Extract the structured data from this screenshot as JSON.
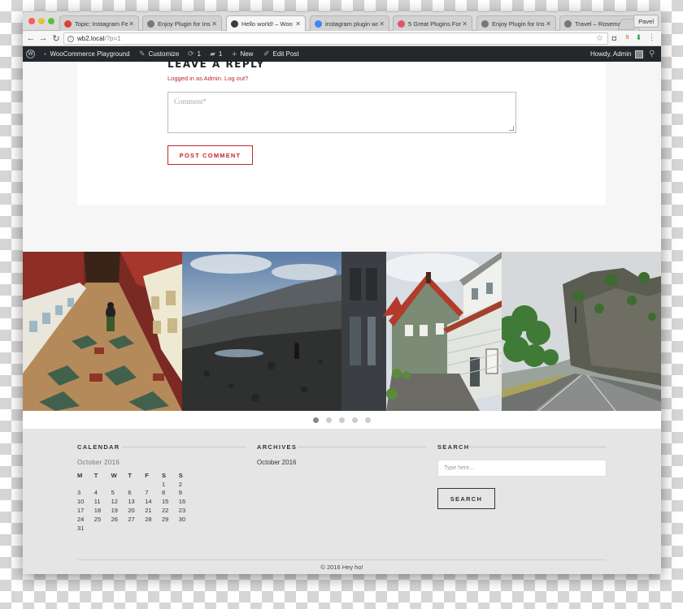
{
  "browser": {
    "tabs": [
      {
        "title": "Topic: Instagram Fe",
        "favicon": "red-plane-icon",
        "color": "#d9413a"
      },
      {
        "title": "Enjoy Plugin for Ins",
        "favicon": "page-icon",
        "color": "#777777"
      },
      {
        "title": "Hello world! – Woo",
        "favicon": "wordpress-icon",
        "color": "#3c3c3c",
        "active": true
      },
      {
        "title": "instagram plugin wo",
        "favicon": "google-icon",
        "color": "#4285f4"
      },
      {
        "title": "5 Great Plugins For",
        "favicon": "star-burst-icon",
        "color": "#e0556b"
      },
      {
        "title": "Enjoy Plugin for Ins",
        "favicon": "wordpress-icon",
        "color": "#777777"
      },
      {
        "title": "Travel – Rosemary",
        "favicon": "wordpress-icon",
        "color": "#777777"
      }
    ],
    "tab_close": "✕",
    "profile_name": "Pavel",
    "url_host": "wb2.local",
    "url_path": "/?p=1"
  },
  "adminbar": {
    "site_name": "WooCommerce Playground",
    "customize": "Customize",
    "updates_count": "1",
    "comments_count": "1",
    "new_label": "New",
    "edit_post": "Edit Post",
    "greeting": "Howdy, Admin"
  },
  "reply": {
    "title": "LEAVE A REPLY",
    "logged_in": "Logged in as Admin. Log out?",
    "comment_placeholder": "Comment*",
    "post_button": "POST COMMENT"
  },
  "gallery": {
    "slide_count": 5,
    "active_index": 0
  },
  "footer": {
    "calendar": {
      "title": "CALENDAR",
      "caption": "October 2016",
      "days": [
        "M",
        "T",
        "W",
        "T",
        "F",
        "S",
        "S"
      ],
      "weeks": [
        [
          "",
          "",
          "",
          "",
          "",
          "1",
          "2"
        ],
        [
          "3",
          "4",
          "5",
          "6",
          "7",
          "8",
          "9"
        ],
        [
          "10",
          "11",
          "12",
          "13",
          "14",
          "15",
          "16"
        ],
        [
          "17",
          "18",
          "19",
          "20",
          "21",
          "22",
          "23"
        ],
        [
          "24",
          "25",
          "26",
          "27",
          "28",
          "29",
          "30"
        ],
        [
          "31",
          "",
          "",
          "",
          "",
          "",
          ""
        ]
      ]
    },
    "archives": {
      "title": "ARCHIVES",
      "items": [
        "October 2016"
      ]
    },
    "search": {
      "title": "SEARCH",
      "placeholder": "Type here...",
      "button": "SEARCH"
    },
    "copyright": "© 2016 Hey ho!"
  },
  "colors": {
    "accent_red": "#c1272d",
    "admin_bar": "#23282d",
    "footer_bg": "#e5e5e5"
  }
}
